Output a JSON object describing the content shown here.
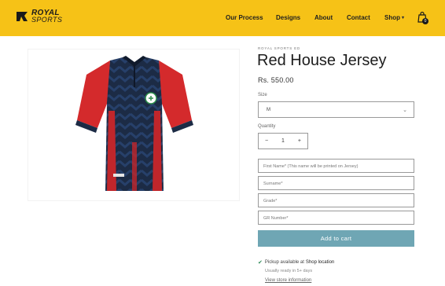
{
  "colors": {
    "header_bg": "#f6c217",
    "cart_button": "#6fa6b4",
    "check": "#2e8b57"
  },
  "brand": {
    "line1": "ROYAL",
    "line2": "SPORTS"
  },
  "nav": {
    "items": [
      {
        "label": "Our Process"
      },
      {
        "label": "Designs"
      },
      {
        "label": "About"
      },
      {
        "label": "Contact"
      },
      {
        "label": "Shop"
      }
    ],
    "cart_icon": "shopping-bag-icon",
    "cart_count": "0"
  },
  "product": {
    "vendor": "ROYAL SPORTS ED",
    "title": "Red House Jersey",
    "price": "Rs. 550.00",
    "size_label": "Size",
    "size_value": "M",
    "quantity_label": "Quantity",
    "quantity_value": "1",
    "minus": "−",
    "plus": "+",
    "fields": [
      {
        "placeholder": "First Name* (This name will be printed on Jersey)"
      },
      {
        "placeholder": "Surname*"
      },
      {
        "placeholder": "Grade*"
      },
      {
        "placeholder": "GR Number*"
      }
    ],
    "add_to_cart": "Add to cart",
    "pickup_text": "Pickup available at",
    "pickup_location": "Shop location",
    "ready_text": "Usually ready in 5+ days",
    "store_link": "View store information"
  }
}
